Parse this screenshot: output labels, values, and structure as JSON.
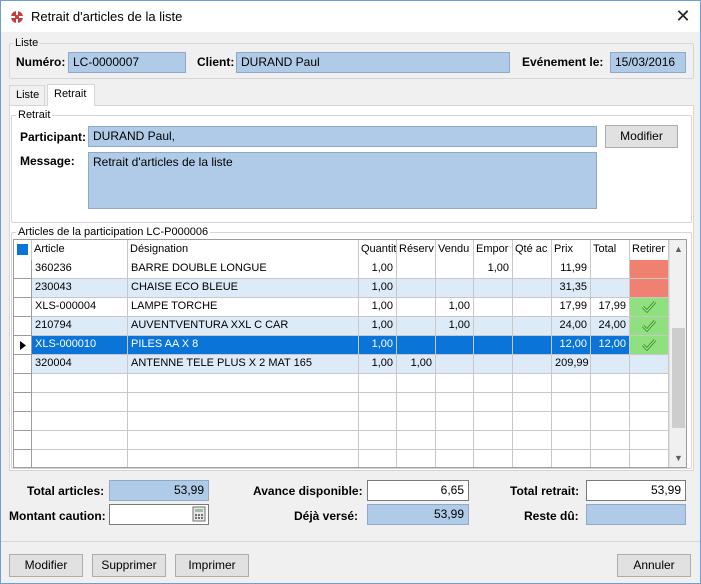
{
  "window": {
    "title": "Retrait d'articles de la liste",
    "close": "✕"
  },
  "liste_group": {
    "legend": "Liste",
    "numero_label": "Numéro:",
    "numero_value": "LC-0000007",
    "client_label": "Client:",
    "client_value": "DURAND Paul",
    "evenement_label": "Evénement le:",
    "evenement_value": "15/03/2016"
  },
  "tabs": [
    {
      "label": "Liste"
    },
    {
      "label": "Retrait"
    }
  ],
  "retrait_group": {
    "legend": "Retrait",
    "participant_label": "Participant:",
    "participant_value": "DURAND Paul,",
    "modifier_label": "Modifier",
    "message_label": "Message:",
    "message_value": "Retrait d'articles de la liste"
  },
  "articles_group": {
    "legend": "Articles de la participation LC-P000006",
    "columns": [
      "Article",
      "Désignation",
      "Quantit",
      "Réserv",
      "Vendu",
      "Empor",
      "Qté ac",
      "Prix",
      "Total",
      "Retirer"
    ],
    "rows": [
      {
        "article": "360236",
        "designation": "BARRE DOUBLE LONGUE",
        "quantite": "1,00",
        "reserve": "",
        "vendu": "",
        "emporte": "1,00",
        "qte_ac": "",
        "prix": "11,99",
        "total": "",
        "retirer": "red"
      },
      {
        "article": "230043",
        "designation": "CHAISE ECO BLEUE",
        "quantite": "1,00",
        "reserve": "",
        "vendu": "",
        "emporte": "",
        "qte_ac": "",
        "prix": "31,35",
        "total": "",
        "retirer": "red"
      },
      {
        "article": "XLS-000004",
        "designation": "LAMPE TORCHE",
        "quantite": "1,00",
        "reserve": "",
        "vendu": "1,00",
        "emporte": "",
        "qte_ac": "",
        "prix": "17,99",
        "total": "17,99",
        "retirer": "check"
      },
      {
        "article": "210794",
        "designation": "AUVENTVENTURA XXL C CAR",
        "quantite": "1,00",
        "reserve": "",
        "vendu": "1,00",
        "emporte": "",
        "qte_ac": "",
        "prix": "24,00",
        "total": "24,00",
        "retirer": "check"
      },
      {
        "article": "XLS-000010",
        "designation": "PILES AA X 8",
        "quantite": "1,00",
        "reserve": "",
        "vendu": "",
        "emporte": "",
        "qte_ac": "",
        "prix": "12,00",
        "total": "12,00",
        "retirer": "check"
      },
      {
        "article": "320004",
        "designation": "ANTENNE TELE PLUS X 2  MAT 165",
        "quantite": "1,00",
        "reserve": "1,00",
        "vendu": "",
        "emporte": "",
        "qte_ac": "",
        "prix": "209,99",
        "total": "",
        "retirer": "none"
      }
    ]
  },
  "totals": {
    "total_articles_label": "Total articles:",
    "total_articles_value": "53,99",
    "avance_label": "Avance disponible:",
    "avance_value": "6,65",
    "total_retrait_label": "Total retrait:",
    "total_retrait_value": "53,99",
    "montant_caution_label": "Montant caution:",
    "montant_caution_value": "",
    "deja_verse_label": "Déjà versé:",
    "deja_verse_value": "53,99",
    "reste_du_label": "Reste dû:",
    "reste_du_value": ""
  },
  "buttons": {
    "modifier": "Modifier",
    "supprimer": "Supprimer",
    "imprimer": "Imprimer",
    "annuler": "Annuler"
  },
  "colors": {
    "field_blue": "#b0cbe8",
    "selection": "#0a74d8",
    "retirer_red": "#f08070",
    "retirer_green": "#90e080"
  }
}
